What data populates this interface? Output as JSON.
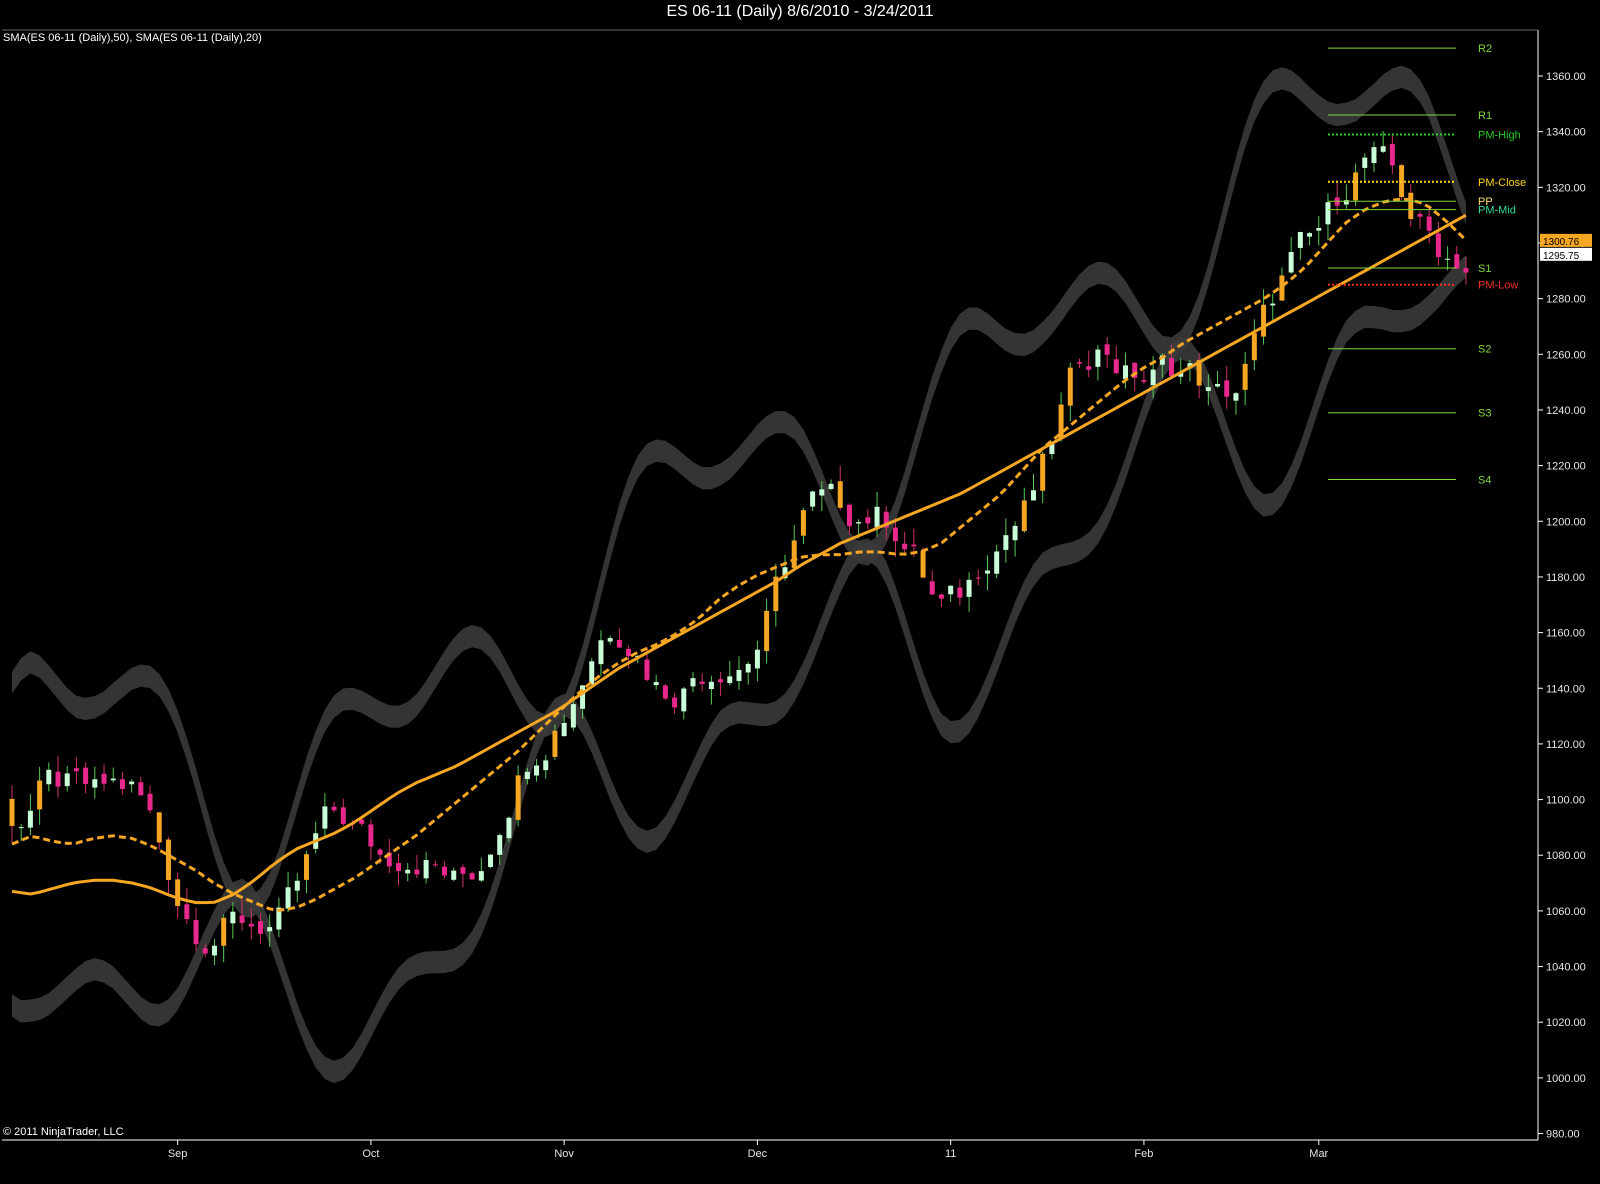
{
  "header": {
    "title": "ES 06-11 (Daily)  8/6/2010 - 3/24/2011",
    "indicators": "SMA(ES 06-11 (Daily),50), SMA(ES 06-11 (Daily),20)",
    "copyright": "© 2011 NinjaTrader, LLC"
  },
  "colors": {
    "background": "#000000",
    "axis": "#ffffff",
    "sma": "#f5a623",
    "band": "#3a3a3a",
    "up_candle": "#c8ffd8",
    "down_candle": "#e8288c",
    "signal_up": "#66ff33",
    "signal_down": "#ff6a55",
    "pivot_line": "#7fd93a",
    "pm_high": "#22cc22",
    "pm_close": "#ffd21a",
    "pm_low": "#ee3322"
  },
  "chart_data": {
    "type": "candlestick",
    "title": "ES 06-11 (Daily)  8/6/2010 - 3/24/2011",
    "ylim": [
      975,
      1370
    ],
    "y_ticks": [
      980,
      1000,
      1020,
      1040,
      1060,
      1080,
      1100,
      1120,
      1140,
      1160,
      1180,
      1200,
      1220,
      1240,
      1260,
      1280,
      1300,
      1320,
      1340,
      1360
    ],
    "y_tick_labels": [
      "980.00",
      "1000.00",
      "1020.00",
      "1040.00",
      "1060.00",
      "1080.00",
      "1100.00",
      "1120.00",
      "1140.00",
      "1160.00",
      "1180.00",
      "1200.00",
      "1220.00",
      "1240.00",
      "1260.00",
      "1280.00",
      "1300.00",
      "1320.00",
      "1340.00",
      "1360.00"
    ],
    "x_ticks": [
      {
        "label": "Sep",
        "index": 18
      },
      {
        "label": "Oct",
        "index": 39
      },
      {
        "label": "Nov",
        "index": 60
      },
      {
        "label": "Dec",
        "index": 81
      },
      {
        "label": "11",
        "index": 102
      },
      {
        "label": "Feb",
        "index": 123
      },
      {
        "label": "Mar",
        "index": 142
      }
    ],
    "bar_count": 159,
    "series": [
      {
        "name": "SMA(ES 06-11 (Daily),50)",
        "style": "solid",
        "values": [
          1067,
          1066,
          1068,
          1070,
          1071,
          1071,
          1070,
          1068,
          1065,
          1063,
          1063,
          1066,
          1071,
          1077,
          1082,
          1085,
          1088,
          1092,
          1097,
          1102,
          1106,
          1109,
          1112,
          1116,
          1120,
          1124,
          1128,
          1132,
          1137,
          1142,
          1147,
          1151,
          1155,
          1159,
          1163,
          1167,
          1171,
          1175,
          1179,
          1184,
          1188,
          1192,
          1195,
          1198,
          1201,
          1204,
          1207,
          1210,
          1214,
          1218,
          1222,
          1226,
          1230,
          1234,
          1238,
          1242,
          1246,
          1250,
          1254,
          1258,
          1262,
          1266,
          1270,
          1274,
          1278,
          1282,
          1286,
          1290,
          1294,
          1298,
          1302,
          1306,
          1310
        ]
      },
      {
        "name": "SMA(ES 06-11 (Daily),20)",
        "style": "dashed",
        "values": [
          1084,
          1087,
          1085,
          1084,
          1086,
          1087,
          1086,
          1083,
          1079,
          1075,
          1070,
          1066,
          1063,
          1060,
          1061,
          1064,
          1068,
          1072,
          1077,
          1082,
          1087,
          1093,
          1099,
          1105,
          1111,
          1117,
          1124,
          1131,
          1138,
          1144,
          1149,
          1153,
          1156,
          1160,
          1165,
          1172,
          1177,
          1181,
          1184,
          1187,
          1188,
          1188,
          1189,
          1189,
          1188,
          1189,
          1192,
          1198,
          1204,
          1210,
          1218,
          1226,
          1232,
          1238,
          1244,
          1250,
          1255,
          1259,
          1264,
          1268,
          1272,
          1276,
          1280,
          1285,
          1291,
          1299,
          1307,
          1312,
          1315,
          1316,
          1314,
          1308,
          1301
        ]
      }
    ],
    "annotations": [
      {
        "label": "R2",
        "value": 1370
      },
      {
        "label": "R1",
        "value": 1346
      },
      {
        "label": "PM-High",
        "value": 1339
      },
      {
        "label": "PM-Close",
        "value": 1322
      },
      {
        "label": "PP",
        "value": 1315
      },
      {
        "label": "PM-Mid",
        "value": 1312
      },
      {
        "label": "S1",
        "value": 1291
      },
      {
        "label": "PM-Low",
        "value": 1285
      },
      {
        "label": "S2",
        "value": 1262
      },
      {
        "label": "S3",
        "value": 1239
      },
      {
        "label": "S4",
        "value": 1215
      }
    ],
    "price_markers": [
      {
        "label": "1300.76",
        "value": 1300.76
      },
      {
        "label": "1295.75",
        "value": 1295.75
      }
    ],
    "grid": false,
    "legend": "top-left"
  }
}
